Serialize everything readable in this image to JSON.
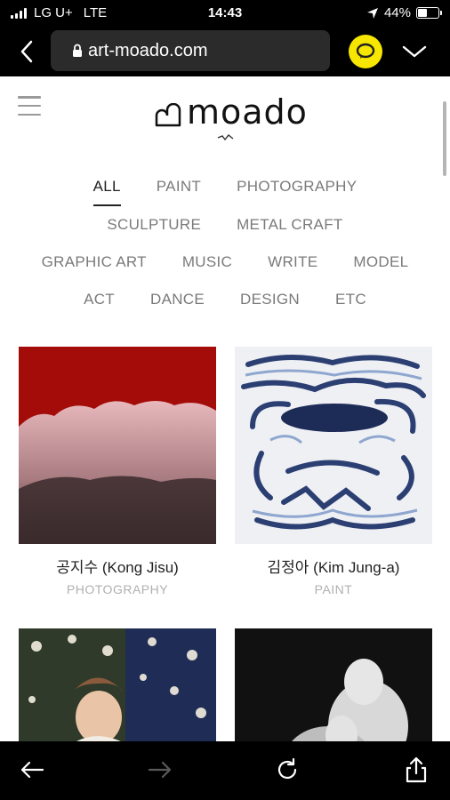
{
  "status": {
    "carrier": "LG U+",
    "network": "LTE",
    "time": "14:43",
    "battery": "44%",
    "battery_level": 0.44
  },
  "browser": {
    "url": "art-moado.com",
    "icons": {
      "back": "back-chevron-icon",
      "lock": "lock-icon",
      "chat": "kakaotalk-chat-icon",
      "menu": "chevron-down-icon"
    }
  },
  "site": {
    "logo": "moado",
    "categories": [
      [
        "ALL",
        "PAINT",
        "PHOTOGRAPHY"
      ],
      [
        "SCULPTURE",
        "METAL CRAFT"
      ],
      [
        "GRAPHIC ART",
        "MUSIC",
        "WRITE",
        "MODEL"
      ],
      [
        "ACT",
        "DANCE",
        "DESIGN",
        "ETC"
      ]
    ],
    "active_category": "ALL",
    "works": [
      {
        "name": "공지수 (Kong Jisu)",
        "category": "PHOTOGRAPHY"
      },
      {
        "name": "김정아 (Kim Jung-a)",
        "category": "PAINT"
      },
      {
        "name": "",
        "category": ""
      },
      {
        "name": "",
        "category": ""
      }
    ]
  },
  "toolbar": {
    "icons": [
      "back-arrow-icon",
      "forward-arrow-icon",
      "reload-icon",
      "share-icon"
    ]
  }
}
